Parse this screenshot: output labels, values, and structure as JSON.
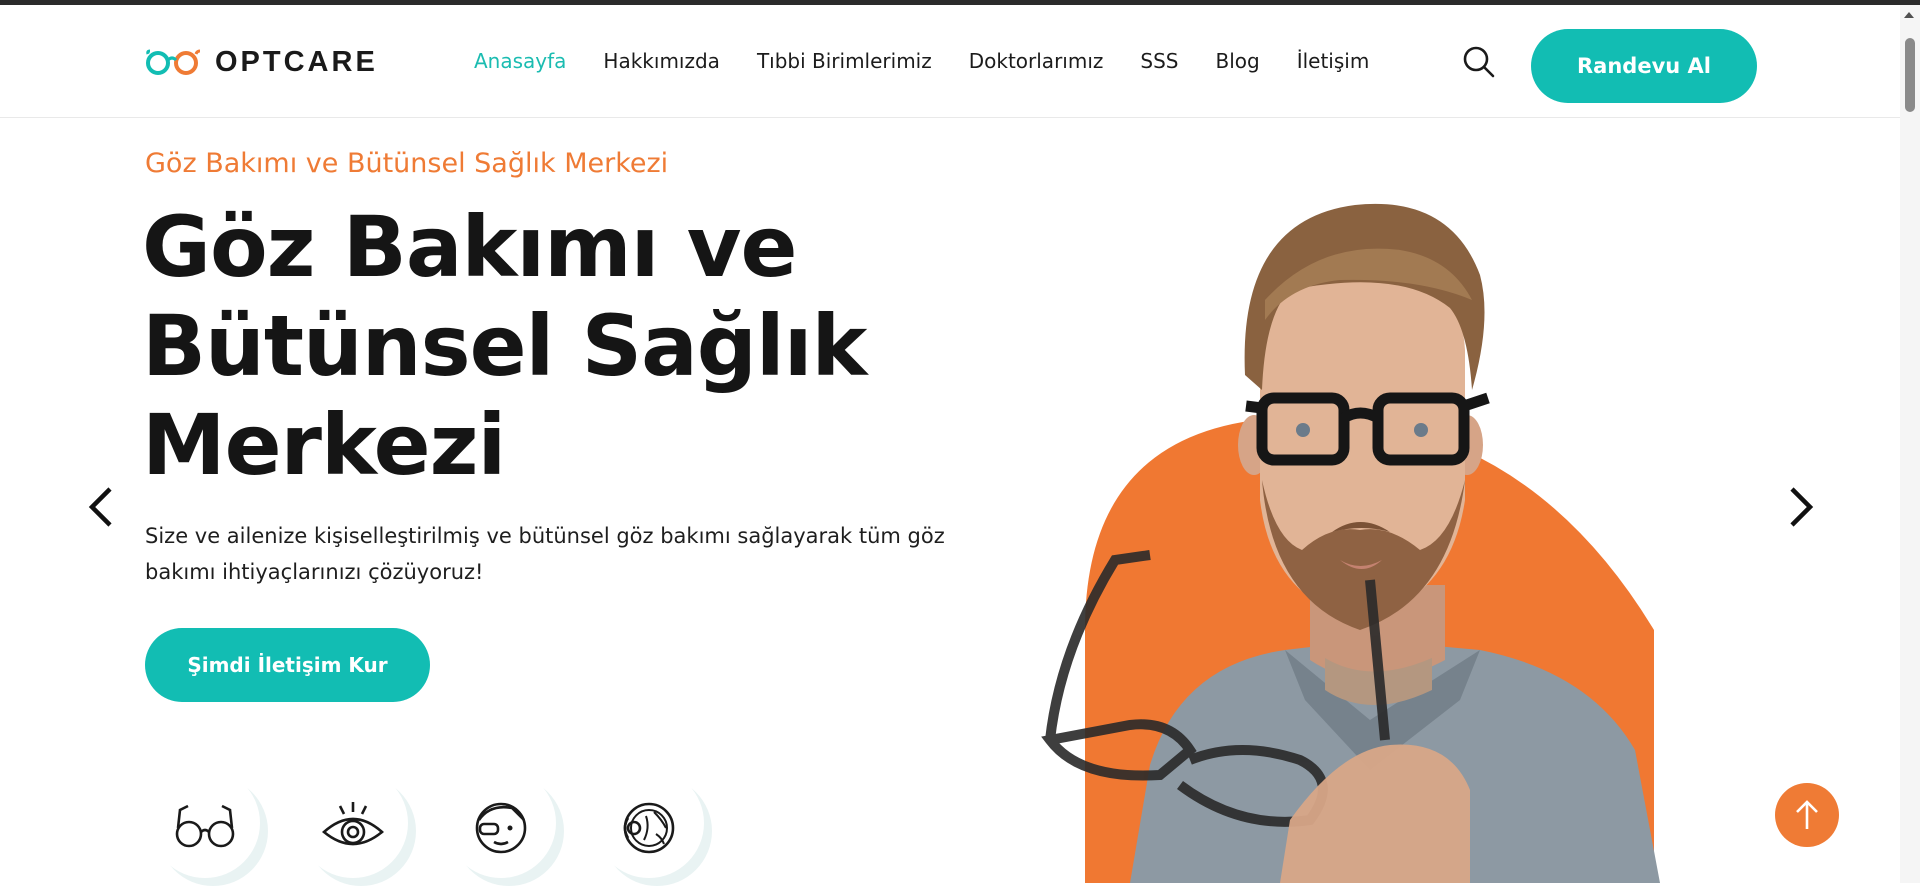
{
  "header": {
    "logo_text": "OPTCARE",
    "nav": [
      {
        "label": "Anasayfa",
        "active": true
      },
      {
        "label": "Hakkımızda",
        "active": false
      },
      {
        "label": "Tıbbi Birimlerimiz",
        "active": false
      },
      {
        "label": "Doktorlarımız",
        "active": false
      },
      {
        "label": "SSS",
        "active": false
      },
      {
        "label": "Blog",
        "active": false
      },
      {
        "label": "İletişim",
        "active": false
      }
    ],
    "search_icon": "search-icon",
    "cta_label": "Randevu Al"
  },
  "hero": {
    "eyebrow": "Göz Bakımı ve Bütünsel Sağlık Merkezi",
    "headline_lines": [
      "Göz Bakımı ve",
      "Bütünsel Sağlık",
      "Merkezi"
    ],
    "lead_lines": [
      "Size ve ailenize kişiselleştirilmiş ve bütünsel göz bakımı sağlayarak tüm göz",
      "bakımı ihtiyaçlarınızı çözüyoruz!"
    ],
    "button_label": "Şimdi İletişim Kur",
    "prev_icon": "chevron-left-icon",
    "next_icon": "chevron-right-icon",
    "service_icons": [
      "glasses-icon",
      "eye-icon",
      "eye-patient-icon",
      "eyeball-anatomy-icon"
    ]
  },
  "colors": {
    "accent": "#12bdb3",
    "orange": "#ef7b35",
    "text": "#151515"
  },
  "back_to_top_icon": "arrow-up-icon"
}
